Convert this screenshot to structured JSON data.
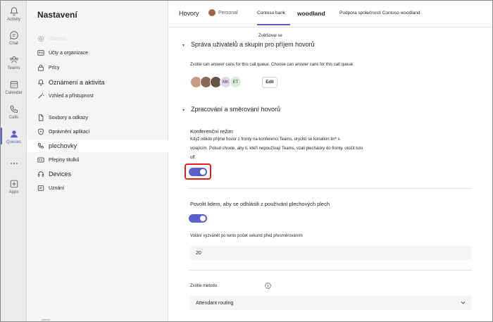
{
  "rail": {
    "items": [
      {
        "id": "activity",
        "label": "Activity",
        "icon": "bell-icon"
      },
      {
        "id": "chat",
        "label": "Chat",
        "icon": "chat-icon"
      },
      {
        "id": "teams",
        "label": "Teams",
        "icon": "teams-icon"
      },
      {
        "id": "calendar",
        "label": "Calendar",
        "icon": "calendar-icon"
      },
      {
        "id": "calls",
        "label": "Calls",
        "icon": "phone-icon"
      },
      {
        "id": "queues",
        "label": "Queues",
        "icon": "queues-icon",
        "active": true
      },
      {
        "id": "more",
        "label": "",
        "icon": "more-icon"
      },
      {
        "id": "apps",
        "label": "Apps",
        "icon": "apps-icon"
      }
    ]
  },
  "leftnav": {
    "title": "Nastavení",
    "items": [
      {
        "label": "Obecné",
        "icon": "gear-icon",
        "faint": true
      },
      {
        "label": "Účty a organizace",
        "icon": "account-icon"
      },
      {
        "label": "Prlcy",
        "icon": "privacy-icon"
      },
      {
        "label": "Oznámení a aktivita",
        "icon": "bell-icon",
        "big": true
      },
      {
        "label": "Vzhled a přístupnost",
        "icon": "wand-icon"
      },
      {
        "label": "Soubory a odkazy",
        "icon": "file-icon"
      },
      {
        "label": "Oprávnění aplikací",
        "icon": "shield-icon"
      },
      {
        "label": "plechovky",
        "icon": "phone-icon",
        "selected": true
      },
      {
        "label": "Přepisy titulků",
        "icon": "captions-icon"
      },
      {
        "label": "Devices",
        "icon": "headset-icon",
        "big": true
      },
      {
        "label": "Uznání",
        "icon": "recognition-icon"
      }
    ]
  },
  "header": {
    "title": "Hovory",
    "personal": "Personal",
    "tab1": "Contoso bank",
    "tab2": "woodland",
    "tab3": "Podpora společnosti Contoso woodland"
  },
  "content": {
    "tooltip": "Zvětšoval se",
    "section1_title": "Správa uživatelů a skupin pro příjem hovorů",
    "section1_desc": "Zvolte can answer cans for this call queue. Choose can answer cans for this call queue.",
    "avatars": [
      {
        "initials": "",
        "color": "#c99a86"
      },
      {
        "initials": "",
        "color": "#8a6a5a"
      },
      {
        "initials": "",
        "color": "#6a5040"
      },
      {
        "initials": "MK",
        "color": "#e4d8f0"
      },
      {
        "initials": "ET",
        "color": "#d8ecd8"
      }
    ],
    "edit_label": "Edit",
    "section2_title": "Zpracování a směrování hovorů",
    "conf_title": "Konferenční režim",
    "conf_desc_1": "Když někdo přijme hovor z fronty na konferenci Teams, urychlí se konation tin* s",
    "conf_desc_2": "volajícím. Pokud chcete, aby ti, kteří nepoužívají Teams, vzali plechásky do fronty. otočit tuto",
    "conf_desc_3": "off.",
    "conf_toggle": true,
    "optout_title": "Povolit lidem, aby se odhlásili z používání plechových plech",
    "optout_toggle": true,
    "wait_label": "Volání vyzvánět po tento počet sekund před přesměrováním",
    "wait_value": "20",
    "method_label": "Zvolte metodu",
    "method_value": "Attendant routing"
  },
  "colors": {
    "accent": "#5b5fc7",
    "highlight": "#e02020"
  }
}
